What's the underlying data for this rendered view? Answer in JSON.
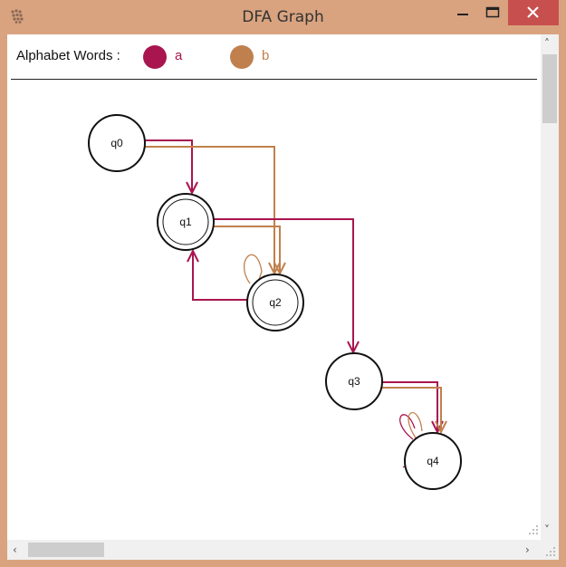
{
  "window": {
    "title": "DFA Graph"
  },
  "legend": {
    "title": "Alphabet Words :",
    "symbols": [
      {
        "label": "a",
        "color": "#a8154f"
      },
      {
        "label": "b",
        "color": "#c0804d"
      }
    ]
  },
  "states": [
    {
      "id": "q0",
      "label": "q0",
      "accepting": false
    },
    {
      "id": "q1",
      "label": "q1",
      "accepting": true
    },
    {
      "id": "q2",
      "label": "q2",
      "accepting": true
    },
    {
      "id": "q3",
      "label": "q3",
      "accepting": false
    },
    {
      "id": "q4",
      "label": "q4",
      "accepting": false
    }
  ],
  "transitions": [
    {
      "from": "q0",
      "to": "q1",
      "symbol": "a"
    },
    {
      "from": "q0",
      "to": "q2",
      "symbol": "b"
    },
    {
      "from": "q1",
      "to": "q3",
      "symbol": "a"
    },
    {
      "from": "q1",
      "to": "q2",
      "symbol": "b"
    },
    {
      "from": "q2",
      "to": "q1",
      "symbol": "a"
    },
    {
      "from": "q2",
      "to": "q2",
      "symbol": "b"
    },
    {
      "from": "q3",
      "to": "q4",
      "symbol": "a"
    },
    {
      "from": "q3",
      "to": "q4",
      "symbol": "b"
    },
    {
      "from": "q4",
      "to": "q4",
      "symbol": "a"
    },
    {
      "from": "q4",
      "to": "q4",
      "symbol": "b"
    }
  ],
  "colors": {
    "accent_a": "#a8154f",
    "accent_b": "#c0804d",
    "close": "#c7504f",
    "frame": "#d9a37f"
  }
}
